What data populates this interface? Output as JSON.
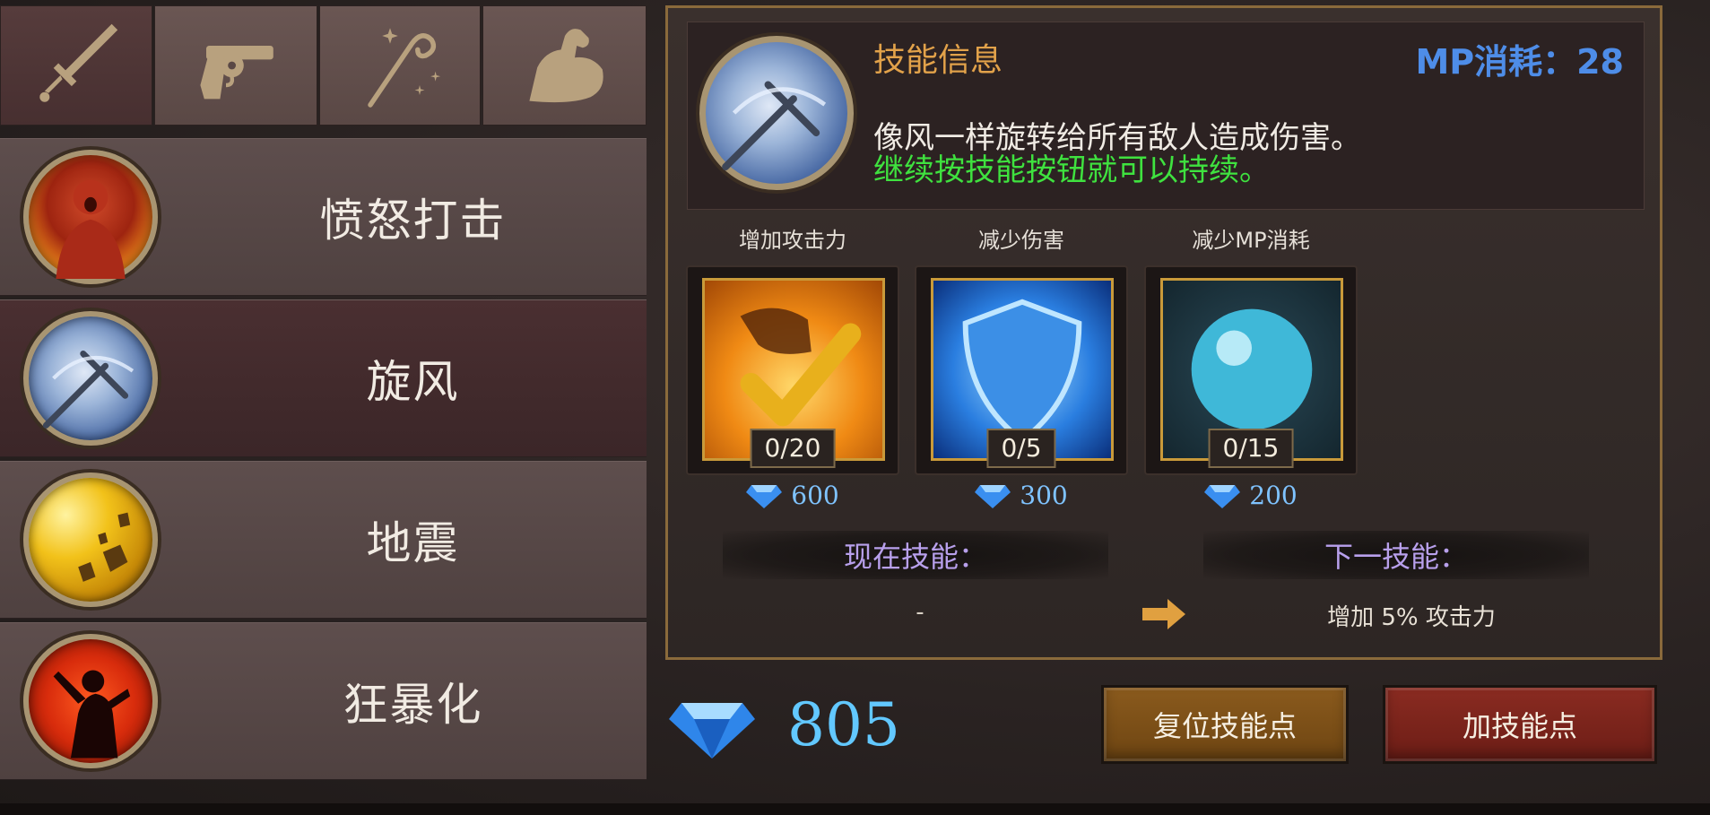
{
  "tabs": [
    {
      "icon": "sword-icon",
      "active": true
    },
    {
      "icon": "revolver-icon",
      "active": false
    },
    {
      "icon": "magic-staff-icon",
      "active": false
    },
    {
      "icon": "flexed-arm-icon",
      "active": false
    }
  ],
  "skills": [
    {
      "name": "愤怒打击",
      "icon": "rage-strike-icon"
    },
    {
      "name": "旋风",
      "icon": "whirlwind-icon",
      "selected": true
    },
    {
      "name": "地震",
      "icon": "earthquake-icon"
    },
    {
      "name": "狂暴化",
      "icon": "berserk-icon"
    }
  ],
  "info": {
    "title": "技能信息",
    "mp_cost": "MP消耗：28",
    "description": "像风一样旋转给所有敌人造成伤害。",
    "hint": "继续按技能按钮就可以持续。"
  },
  "upgrades": [
    {
      "label": "增加攻击力",
      "count": "0/20",
      "cost": "600",
      "icon": "attack-up-icon"
    },
    {
      "label": "减少伤害",
      "count": "0/5",
      "cost": "300",
      "icon": "shield-icon"
    },
    {
      "label": "减少MP消耗",
      "count": "0/15",
      "cost": "200",
      "icon": "mana-orb-icon"
    }
  ],
  "current_skill": {
    "label": "现在技能：",
    "value": "-"
  },
  "next_skill": {
    "label": "下一技能：",
    "value": "增加 5% 攻击力"
  },
  "gems": "805",
  "buttons": {
    "reset": "复位技能点",
    "add": "加技能点"
  },
  "colors": {
    "title_orange": "#e2a24a",
    "mp_blue": "#4e8de8",
    "hint_green": "#3fe23f",
    "gem_blue": "#62c8ff"
  }
}
